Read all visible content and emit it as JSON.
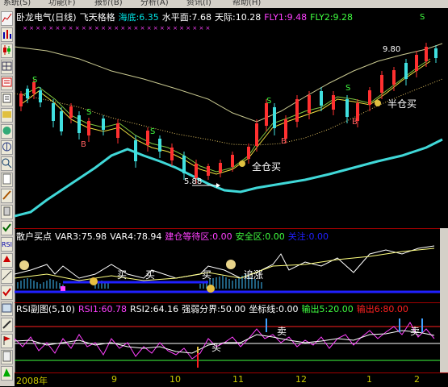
{
  "menu": [
    "系统(S)",
    "功能(F)",
    "报价(B)",
    "分析(A)",
    "资讯(I)",
    "帮助(H)"
  ],
  "toolbar_icons": [
    "chart-icon",
    "bars-icon",
    "candles-icon",
    "grid-icon",
    "list-icon",
    "news-icon",
    "stock-icon",
    "f10-icon",
    "compass-icon",
    "rsi-icon",
    "tool-icon",
    "brush-icon",
    "tick-icon"
  ],
  "main": {
    "title": "卧龙电气(日线)",
    "indicator": "飞天格格",
    "items": [
      {
        "label": "海底:6.35",
        "color": "#00e0e0"
      },
      {
        "label": "水平面:7.68",
        "color": "#ffffff"
      },
      {
        "label": "天际:10.28",
        "color": "#ffffff"
      },
      {
        "label": "FLY1:9.48",
        "color": "#ff40ff"
      },
      {
        "label": "FLY2:9.28",
        "color": "#40ff40"
      }
    ],
    "annotations": {
      "full_buy": "全仓买",
      "half_buy": "半仓买",
      "price_low": "5.88",
      "price_high": "9.80",
      "s_marker": "S",
      "b_marker": "B"
    }
  },
  "panel2": {
    "title": "散户买点",
    "items": [
      {
        "label": "VAR3:75.98",
        "color": "#ffffff"
      },
      {
        "label": "VAR4:78.94",
        "color": "#ffffff"
      },
      {
        "label": "建仓等待区:0.00",
        "color": "#ff40ff"
      },
      {
        "label": "安全区:0.00",
        "color": "#40ff40"
      },
      {
        "label": "关注:0.00",
        "color": "#2020ff"
      }
    ],
    "annotations": {
      "buy": "买",
      "chase": "追涨"
    }
  },
  "panel3": {
    "title": "RSI副图(5,10)",
    "items": [
      {
        "label": "RSI1:60.78",
        "color": "#ff40ff"
      },
      {
        "label": "RSI2:64.16",
        "color": "#ffffff"
      },
      {
        "label": "强弱分界:50.00",
        "color": "#ffffff"
      },
      {
        "label": "坐标线:0.00",
        "color": "#ffffff"
      },
      {
        "label": "输出5:20.00",
        "color": "#40ff40"
      },
      {
        "label": "输出6:80.00",
        "color": "#ff2020"
      }
    ],
    "annotations": {
      "buy": "买",
      "sell": "卖"
    }
  },
  "date_axis": [
    "2008年",
    "9",
    "10",
    "11",
    "12",
    "1",
    "2"
  ]
}
